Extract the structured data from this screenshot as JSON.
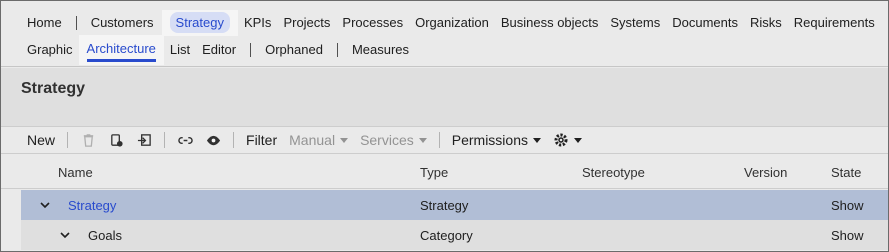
{
  "nav": {
    "primary": [
      {
        "label": "Home"
      },
      {
        "label": "Customers"
      },
      {
        "label": "Strategy",
        "active": true
      },
      {
        "label": "KPIs"
      },
      {
        "label": "Projects"
      },
      {
        "label": "Processes"
      },
      {
        "label": "Organization"
      },
      {
        "label": "Business objects"
      },
      {
        "label": "Systems"
      },
      {
        "label": "Documents"
      },
      {
        "label": "Risks"
      },
      {
        "label": "Requirements"
      }
    ],
    "secondary": [
      {
        "label": "Graphic"
      },
      {
        "label": "Architecture",
        "active": true
      },
      {
        "label": "List"
      },
      {
        "label": "Editor"
      },
      {
        "label": "Orphaned"
      },
      {
        "label": "Measures"
      }
    ]
  },
  "page": {
    "title": "Strategy"
  },
  "toolbar": {
    "new_label": "New",
    "filter_label": "Filter",
    "manual_label": "Manual",
    "services_label": "Services",
    "permissions_label": "Permissions"
  },
  "table": {
    "columns": [
      "Name",
      "Type",
      "Stereotype",
      "Version",
      "State"
    ],
    "rows": [
      {
        "name": "Strategy",
        "type": "Strategy",
        "stereotype": "",
        "version": "",
        "state": "Show"
      },
      {
        "name": "Goals",
        "type": "Category",
        "stereotype": "",
        "version": "",
        "state": "Show"
      }
    ]
  },
  "colors": {
    "accent": "#2b4fd6",
    "selected_row": "#b9c6df"
  }
}
